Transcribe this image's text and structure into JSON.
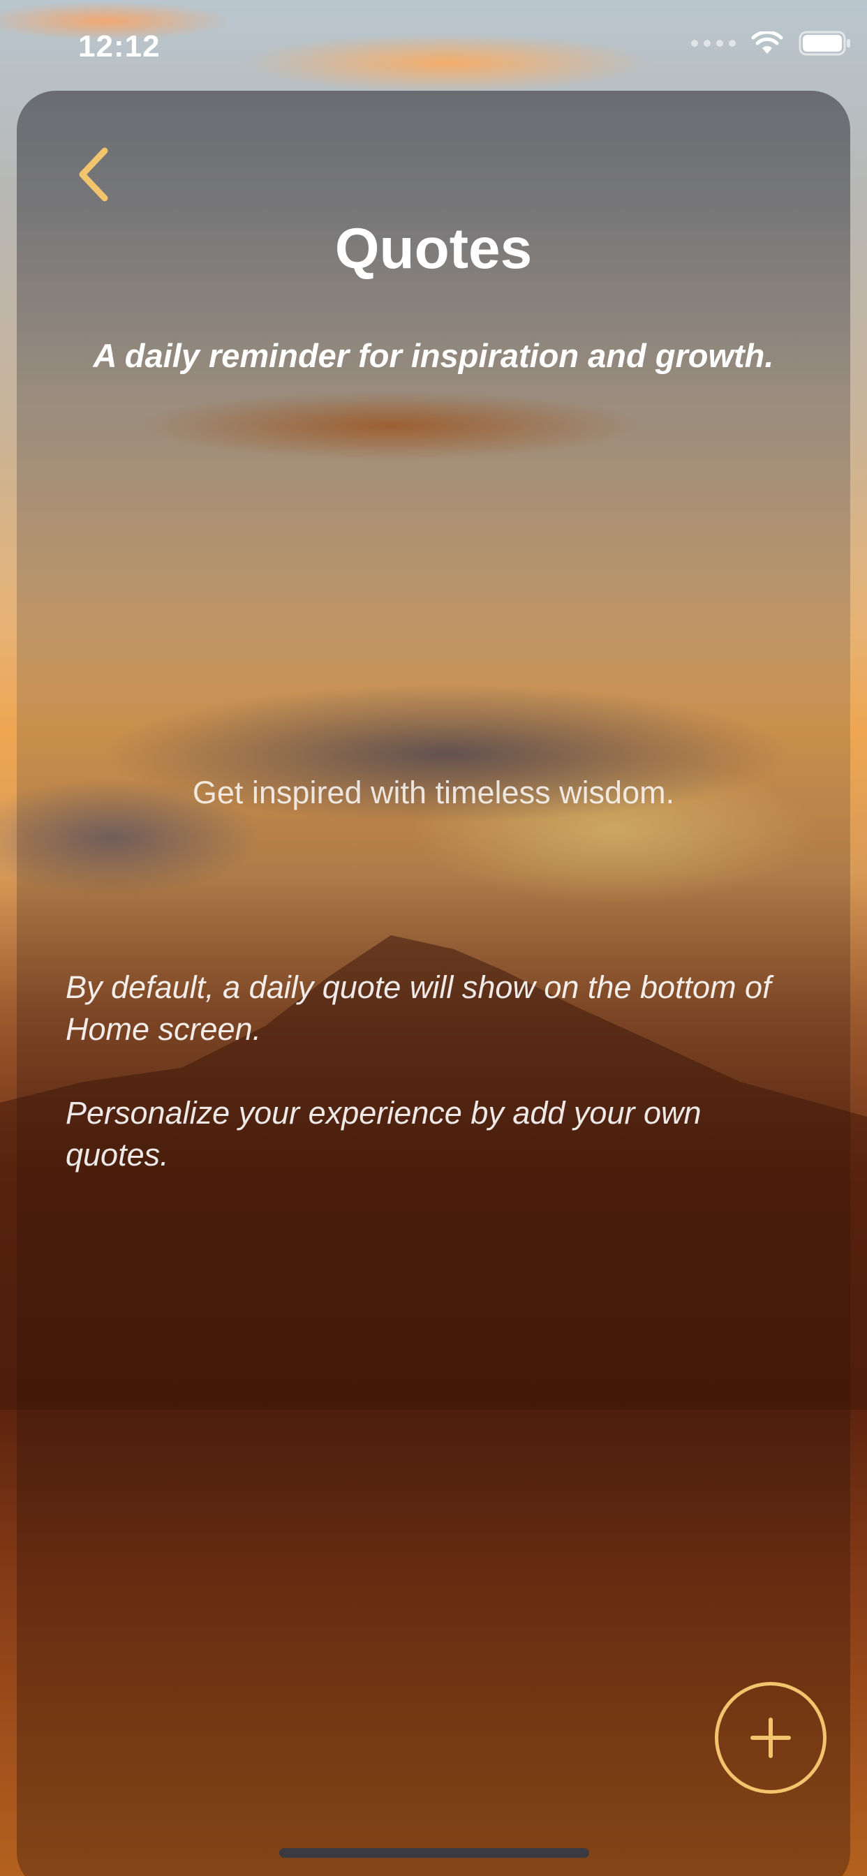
{
  "status_bar": {
    "time": "12:12"
  },
  "header": {
    "back_icon": "chevron-left-icon",
    "title": "Quotes",
    "subtitle": "A daily reminder for inspiration and growth."
  },
  "main": {
    "tagline": "Get inspired with timeless wisdom.",
    "info_1": "By default, a daily quote will show on the bottom of Home screen.",
    "info_2": "Personalize your experience by add your own quotes."
  },
  "actions": {
    "add_icon": "plus-icon"
  },
  "colors": {
    "accent": "#f2c46e",
    "text": "#ffffff"
  }
}
